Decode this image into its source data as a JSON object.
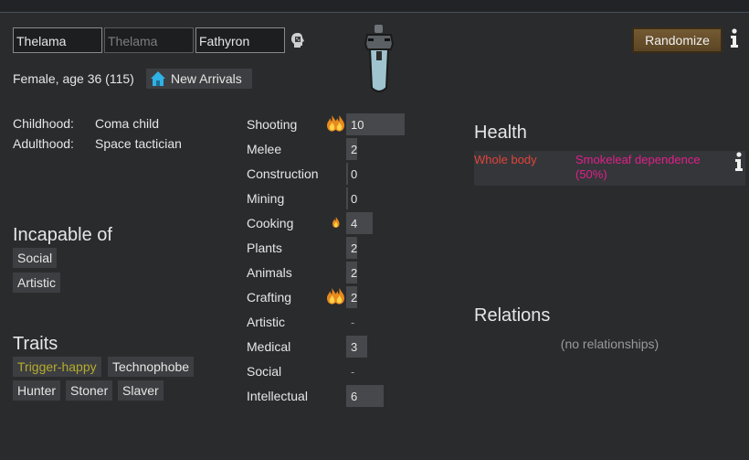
{
  "name": {
    "first": "Thelama",
    "nick_placeholder": "Thelama",
    "last": "Fathyron"
  },
  "header": {
    "summary": "Female, age 36 (115)",
    "faction": "New Arrivals",
    "randomize_label": "Randomize"
  },
  "backstory": {
    "childhood_label": "Childhood:",
    "childhood_value": "Coma child",
    "adulthood_label": "Adulthood:",
    "adulthood_value": "Space tactician"
  },
  "incapable": {
    "title": "Incapable of",
    "items": [
      "Social",
      "Artistic"
    ]
  },
  "traits": {
    "title": "Traits",
    "items": [
      "Trigger-happy",
      "Technophobe",
      "Hunter",
      "Stoner",
      "Slaver"
    ],
    "highlight_color": "#b5ab2e"
  },
  "skills": [
    {
      "name": "Shooting",
      "level": "10",
      "passion": "major"
    },
    {
      "name": "Melee",
      "level": "2",
      "passion": "none"
    },
    {
      "name": "Construction",
      "level": "0",
      "passion": "none"
    },
    {
      "name": "Mining",
      "level": "0",
      "passion": "none"
    },
    {
      "name": "Cooking",
      "level": "4",
      "passion": "minor"
    },
    {
      "name": "Plants",
      "level": "2",
      "passion": "none"
    },
    {
      "name": "Animals",
      "level": "2",
      "passion": "none"
    },
    {
      "name": "Crafting",
      "level": "2",
      "passion": "major"
    },
    {
      "name": "Artistic",
      "level": "-",
      "passion": "none"
    },
    {
      "name": "Medical",
      "level": "3",
      "passion": "none"
    },
    {
      "name": "Social",
      "level": "-",
      "passion": "none"
    },
    {
      "name": "Intellectual",
      "level": "6",
      "passion": "none"
    }
  ],
  "health": {
    "title": "Health",
    "part": "Whole body",
    "condition": "Smokeleaf dependence (50%)",
    "part_color": "#e0443a",
    "condition_color": "#e0208a"
  },
  "relations": {
    "title": "Relations",
    "empty": "(no relationships)"
  },
  "icons": {
    "random_name": "dice-head-icon",
    "faction": "house-icon",
    "info": "info-icon",
    "passion_major": "double-flame-icon",
    "passion_minor": "flame-icon"
  }
}
